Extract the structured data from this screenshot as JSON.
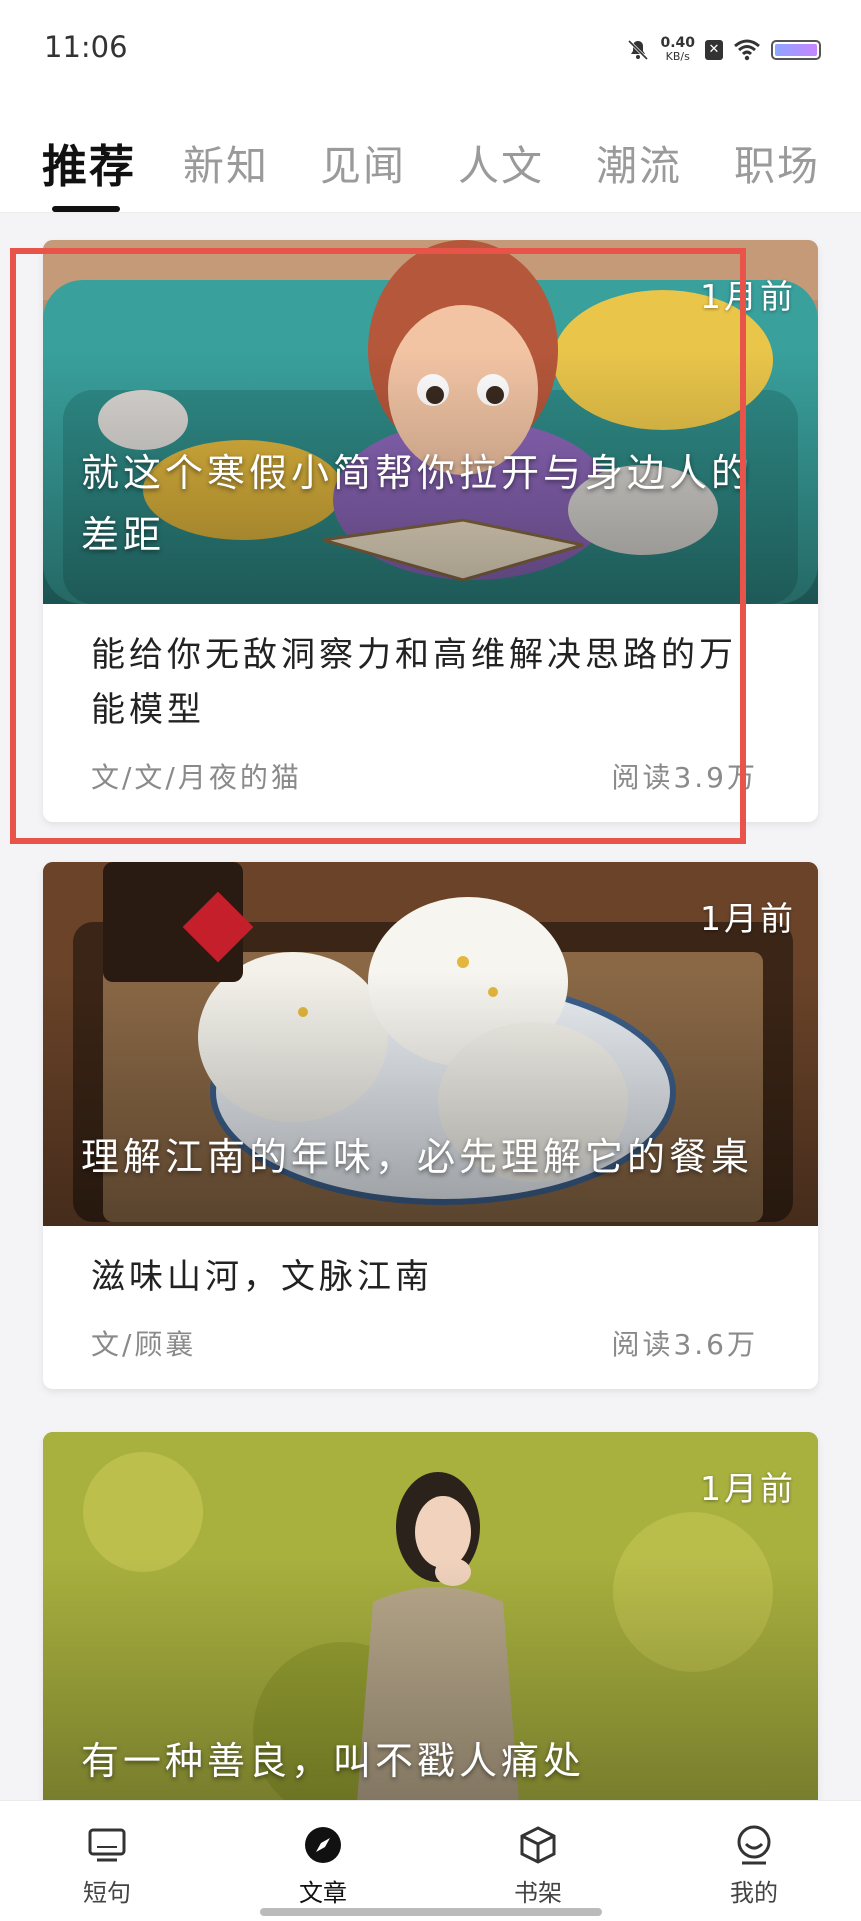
{
  "status": {
    "time": "11:06",
    "speed_value": "0.40",
    "speed_unit": "KB/s"
  },
  "tabs": [
    {
      "label": "推荐",
      "active": true
    },
    {
      "label": "新知"
    },
    {
      "label": "见闻"
    },
    {
      "label": "人文"
    },
    {
      "label": "潮流"
    },
    {
      "label": "职场"
    }
  ],
  "cards": [
    {
      "time": "1月前",
      "overlay_title": "就这个寒假小简帮你拉开与身边人的差距",
      "subtitle": "能给你无敌洞察力和高维解决思路的万能模型",
      "author": "文/文/月夜的猫",
      "reads": "阅读3.9万"
    },
    {
      "time": "1月前",
      "overlay_title": "理解江南的年味，必先理解它的餐桌",
      "subtitle": "滋味山河，文脉江南",
      "author": "文/顾襄",
      "reads": "阅读3.6万"
    },
    {
      "time": "1月前",
      "overlay_title": "有一种善良，叫不戳人痛处"
    }
  ],
  "bottom_nav": [
    {
      "label": "短句",
      "icon": "monitor-icon"
    },
    {
      "label": "文章",
      "icon": "compass-icon",
      "active": true
    },
    {
      "label": "书架",
      "icon": "cube-icon"
    },
    {
      "label": "我的",
      "icon": "smiley-user-icon"
    }
  ],
  "colors": {
    "highlight": "#e8534a",
    "active_tab": "#111111",
    "inactive_tab": "#9a9a9a"
  }
}
